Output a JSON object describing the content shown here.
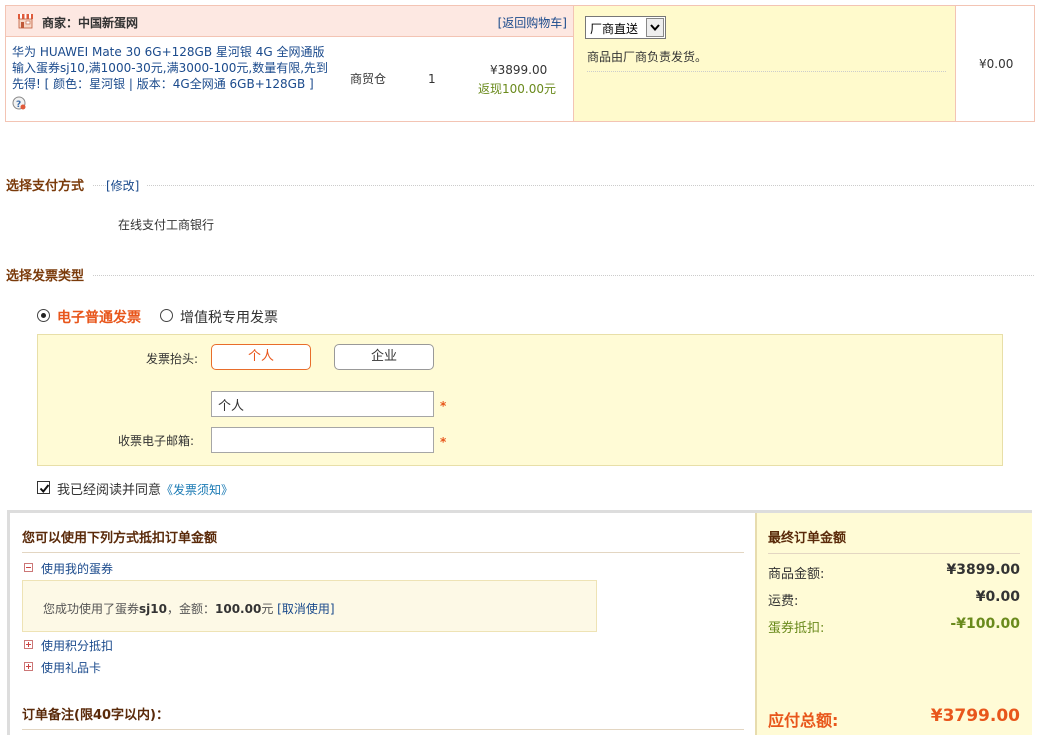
{
  "merchant": {
    "label": "商家：中国新蛋网",
    "back_to_cart": "[返回购物车]"
  },
  "product": {
    "title": "华为 HUAWEI Mate 30 6G+128GB 星河银 4G 全网通版 输入蛋券sj10,满1000-30元,满3000-100元,数量有限,先到先得! [ 颜色：星河银 | 版本：4G全网通 6GB+128GB ]",
    "warehouse": "商贸仓",
    "quantity": "1",
    "price": "¥3899.00",
    "rebate": "返现100.00元"
  },
  "shipping": {
    "selected": "厂商直送",
    "note": "商品由厂商负责发货。",
    "fee": "¥0.00"
  },
  "payment": {
    "title": "选择支付方式",
    "edit": "[修改]",
    "info": "在线支付工商银行"
  },
  "invoice": {
    "title": "选择发票类型",
    "types": [
      {
        "label": "电子普通发票",
        "checked": true
      },
      {
        "label": "增值税专用发票",
        "checked": false
      }
    ],
    "header_label": "发票抬头:",
    "header_options": [
      "个人",
      "企业"
    ],
    "header_value": "个人",
    "email_label": "收票电子邮箱:",
    "email_value": "",
    "required_mark": "*",
    "agree_text": "我已经阅读并同意",
    "agree_link": "《发票须知》"
  },
  "deduction": {
    "title": "您可以使用下列方式抵扣订单金额",
    "coupon_label": "使用我的蛋券",
    "coupon_used_prefix": "您成功使用了蛋券",
    "coupon_code": "sj10",
    "coupon_amount_prefix": "，金额：",
    "coupon_amount": "100.00",
    "coupon_amount_unit": "元",
    "coupon_cancel": "[取消使用]",
    "points_label": "使用积分抵扣",
    "giftcard_label": "使用礼品卡",
    "remark_title": "订单备注(限40字以内)："
  },
  "summary": {
    "title": "最终订单金额",
    "goods_label": "商品金额:",
    "goods_value": "¥3899.00",
    "freight_label": "运费:",
    "freight_value": "¥0.00",
    "coupon_label": "蛋券抵扣:",
    "coupon_value": "-¥100.00",
    "total_label": "应付总额:",
    "total_value": "¥3799.00"
  },
  "colors": {
    "accent_orange": "#e8561b",
    "link_blue": "#1a4a8c",
    "rebate_green": "#6a8a1c",
    "panel_yellow": "#fffbd6"
  }
}
